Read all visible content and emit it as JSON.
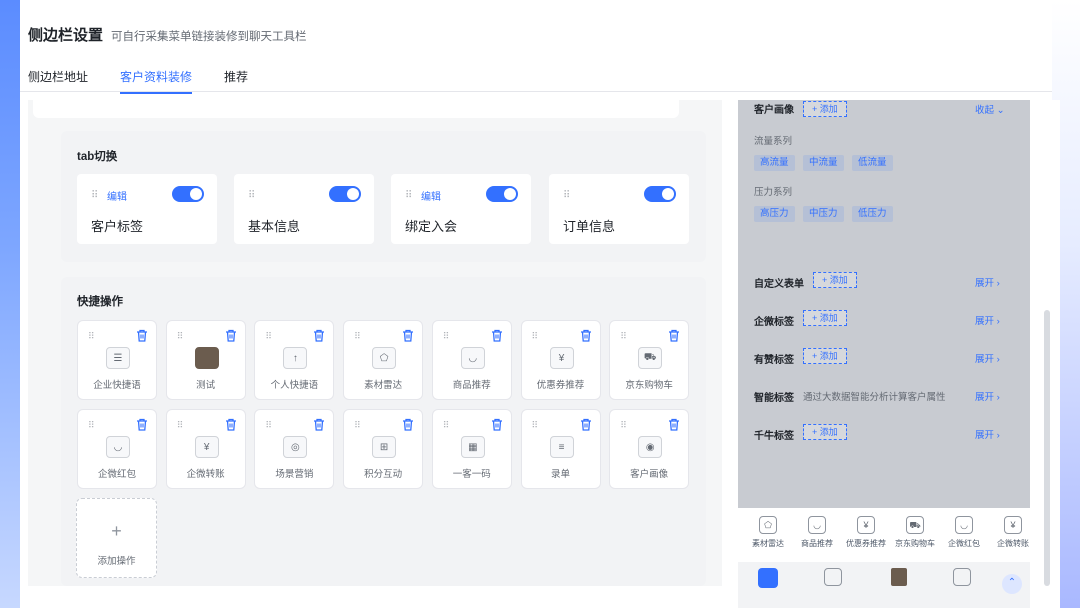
{
  "header": {
    "title": "侧边栏设置",
    "subtitle": "可自行采集菜单链接装修到聊天工具栏"
  },
  "tabs": [
    "侧边栏地址",
    "客户资料装修",
    "推荐"
  ],
  "tab_section": {
    "title": "tab切换",
    "edit_label": "编辑",
    "items": [
      {
        "name": "客户标签",
        "editable": true,
        "enabled": true
      },
      {
        "name": "基本信息",
        "editable": false,
        "enabled": true
      },
      {
        "name": "绑定入会",
        "editable": true,
        "enabled": true
      },
      {
        "name": "订单信息",
        "editable": false,
        "enabled": true
      }
    ]
  },
  "quick_section": {
    "title": "快捷操作",
    "items": [
      {
        "label": "企业快捷语",
        "icon": "chat-icon"
      },
      {
        "label": "测试",
        "icon": "photo-icon"
      },
      {
        "label": "个人快捷语",
        "icon": "share-icon"
      },
      {
        "label": "素材雷达",
        "icon": "pentagon-icon"
      },
      {
        "label": "商品推荐",
        "icon": "bag-icon"
      },
      {
        "label": "优惠券推荐",
        "icon": "coupon-icon"
      },
      {
        "label": "京东购物车",
        "icon": "cart-icon"
      },
      {
        "label": "企微红包",
        "icon": "redpacket-icon"
      },
      {
        "label": "企微转账",
        "icon": "transfer-icon"
      },
      {
        "label": "场景营销",
        "icon": "scene-icon"
      },
      {
        "label": "积分互动",
        "icon": "points-icon"
      },
      {
        "label": "一客一码",
        "icon": "qrcode-icon"
      },
      {
        "label": "录单",
        "icon": "order-icon"
      },
      {
        "label": "客户画像",
        "icon": "portrait-icon"
      }
    ],
    "add_label": "添加操作"
  },
  "preview": {
    "portrait": {
      "label": "客户画像",
      "add": "+ 添加",
      "toggle": "收起"
    },
    "flow_series": {
      "label": "流量系列",
      "chips": [
        "高流量",
        "中流量",
        "低流量"
      ]
    },
    "pressure_series": {
      "label": "压力系列",
      "chips": [
        "高压力",
        "中压力",
        "低压力"
      ]
    },
    "rows": [
      {
        "label": "自定义表单",
        "add": "+ 添加",
        "action": "展开"
      },
      {
        "label": "企微标签",
        "add": "+ 添加",
        "action": "展开"
      },
      {
        "label": "有赞标签",
        "add": "+ 添加",
        "action": "展开"
      },
      {
        "label": "智能标签",
        "desc": "通过大数据智能分析计算客户属性",
        "action": "展开"
      },
      {
        "label": "千牛标签",
        "add": "+ 添加",
        "action": "展开"
      }
    ],
    "bottom_bar": [
      "素材雷达",
      "商品推荐",
      "优惠券推荐",
      "京东购物车",
      "企微红包",
      "企微转账"
    ]
  },
  "colors": {
    "accent": "#3370ff"
  }
}
